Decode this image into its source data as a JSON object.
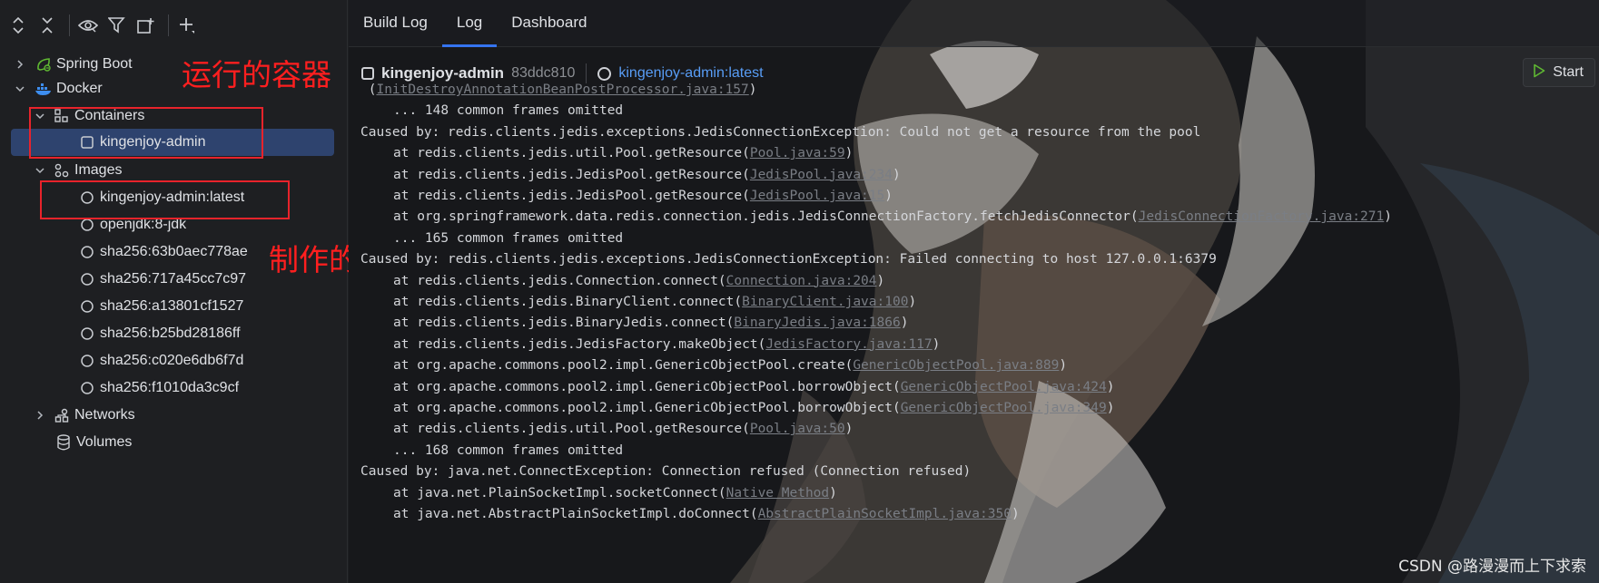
{
  "toolbar": {
    "icons": [
      "expand-all-icon",
      "collapse-all-icon",
      "eye-icon",
      "filter-icon",
      "new-window-icon",
      "add-icon"
    ]
  },
  "tree": {
    "items": [
      {
        "label": "Spring Boot",
        "icon": "spring-boot-icon",
        "chevron": "right"
      },
      {
        "label": "Docker",
        "icon": "docker-icon",
        "chevron": "down"
      },
      {
        "label": "Containers",
        "icon": "containers-icon",
        "chevron": "down"
      },
      {
        "label": "kingenjoy-admin",
        "icon": "container-square-icon",
        "chevron": "",
        "selected": true
      },
      {
        "label": "Images",
        "icon": "images-icon",
        "chevron": "down"
      },
      {
        "label": "kingenjoy-admin:latest",
        "icon": "image-circle-icon",
        "chevron": ""
      },
      {
        "label": "openjdk:8-jdk",
        "icon": "image-circle-icon",
        "chevron": ""
      },
      {
        "label": "sha256:63b0aec778ae",
        "icon": "image-circle-icon",
        "chevron": ""
      },
      {
        "label": "sha256:717a45cc7c97",
        "icon": "image-circle-icon",
        "chevron": ""
      },
      {
        "label": "sha256:a13801cf1527",
        "icon": "image-circle-icon",
        "chevron": ""
      },
      {
        "label": "sha256:b25bd28186ff",
        "icon": "image-circle-icon",
        "chevron": ""
      },
      {
        "label": "sha256:c020e6db6f7d",
        "icon": "image-circle-icon",
        "chevron": ""
      },
      {
        "label": "sha256:f1010da3c9cf",
        "icon": "image-circle-icon",
        "chevron": ""
      },
      {
        "label": "Networks",
        "icon": "networks-icon",
        "chevron": "right"
      },
      {
        "label": "Volumes",
        "icon": "volumes-icon",
        "chevron": ""
      }
    ]
  },
  "annotations": {
    "running_container": "运行的容器",
    "built_image": "制作的镜像"
  },
  "tabs": [
    {
      "label": "Build Log",
      "active": false
    },
    {
      "label": "Log",
      "active": true
    },
    {
      "label": "Dashboard",
      "active": false
    }
  ],
  "context": {
    "container_name": "kingenjoy-admin",
    "container_hash": "83ddc810",
    "image_link": "kingenjoy-admin:latest"
  },
  "start_button": {
    "label": "Start",
    "icon": "play-icon"
  },
  "log_lines": [
    {
      "indent": false,
      "text": " (",
      "link": "InitDestroyAnnotationBeanPostProcessor.java:157",
      "after": ")"
    },
    {
      "indent": true,
      "text": "... 148 common frames omitted",
      "link": "",
      "after": ""
    },
    {
      "indent": false,
      "text": "Caused by: redis.clients.jedis.exceptions.JedisConnectionException: Could not get a resource from the pool",
      "link": "",
      "after": ""
    },
    {
      "indent": true,
      "text": "at redis.clients.jedis.util.Pool.getResource(",
      "link": "Pool.java:59",
      "after": ")"
    },
    {
      "indent": true,
      "text": "at redis.clients.jedis.JedisPool.getResource(",
      "link": "JedisPool.java:234",
      "after": ")"
    },
    {
      "indent": true,
      "text": "at redis.clients.jedis.JedisPool.getResource(",
      "link": "JedisPool.java:15",
      "after": ")"
    },
    {
      "indent": true,
      "text": "at org.springframework.data.redis.connection.jedis.JedisConnectionFactory.fetchJedisConnector(",
      "link": "JedisConnectionFactory.java:271",
      "after": ")"
    },
    {
      "indent": true,
      "text": "... 165 common frames omitted",
      "link": "",
      "after": ""
    },
    {
      "indent": false,
      "text": "Caused by: redis.clients.jedis.exceptions.JedisConnectionException: Failed connecting to host 127.0.0.1:6379",
      "link": "",
      "after": ""
    },
    {
      "indent": true,
      "text": "at redis.clients.jedis.Connection.connect(",
      "link": "Connection.java:204",
      "after": ")"
    },
    {
      "indent": true,
      "text": "at redis.clients.jedis.BinaryClient.connect(",
      "link": "BinaryClient.java:100",
      "after": ")"
    },
    {
      "indent": true,
      "text": "at redis.clients.jedis.BinaryJedis.connect(",
      "link": "BinaryJedis.java:1866",
      "after": ")"
    },
    {
      "indent": true,
      "text": "at redis.clients.jedis.JedisFactory.makeObject(",
      "link": "JedisFactory.java:117",
      "after": ")"
    },
    {
      "indent": true,
      "text": "at org.apache.commons.pool2.impl.GenericObjectPool.create(",
      "link": "GenericObjectPool.java:889",
      "after": ")"
    },
    {
      "indent": true,
      "text": "at org.apache.commons.pool2.impl.GenericObjectPool.borrowObject(",
      "link": "GenericObjectPool.java:424",
      "after": ")"
    },
    {
      "indent": true,
      "text": "at org.apache.commons.pool2.impl.GenericObjectPool.borrowObject(",
      "link": "GenericObjectPool.java:349",
      "after": ")"
    },
    {
      "indent": true,
      "text": "at redis.clients.jedis.util.Pool.getResource(",
      "link": "Pool.java:50",
      "after": ")"
    },
    {
      "indent": true,
      "text": "... 168 common frames omitted",
      "link": "",
      "after": ""
    },
    {
      "indent": false,
      "text": "Caused by: java.net.ConnectException: Connection refused (Connection refused)",
      "link": "",
      "after": ""
    },
    {
      "indent": true,
      "text": "at java.net.PlainSocketImpl.socketConnect(",
      "link": "Native Method",
      "after": ")"
    },
    {
      "indent": true,
      "text": "at java.net.AbstractPlainSocketImpl.doConnect(",
      "link": "AbstractPlainSocketImpl.java:350",
      "after": ")"
    }
  ],
  "watermark": "CSDN @路漫漫而上下求索",
  "colors": {
    "accent": "#3574f0",
    "link": "#589df6",
    "selection": "#2e436e",
    "annotation_red": "#e8232b"
  }
}
